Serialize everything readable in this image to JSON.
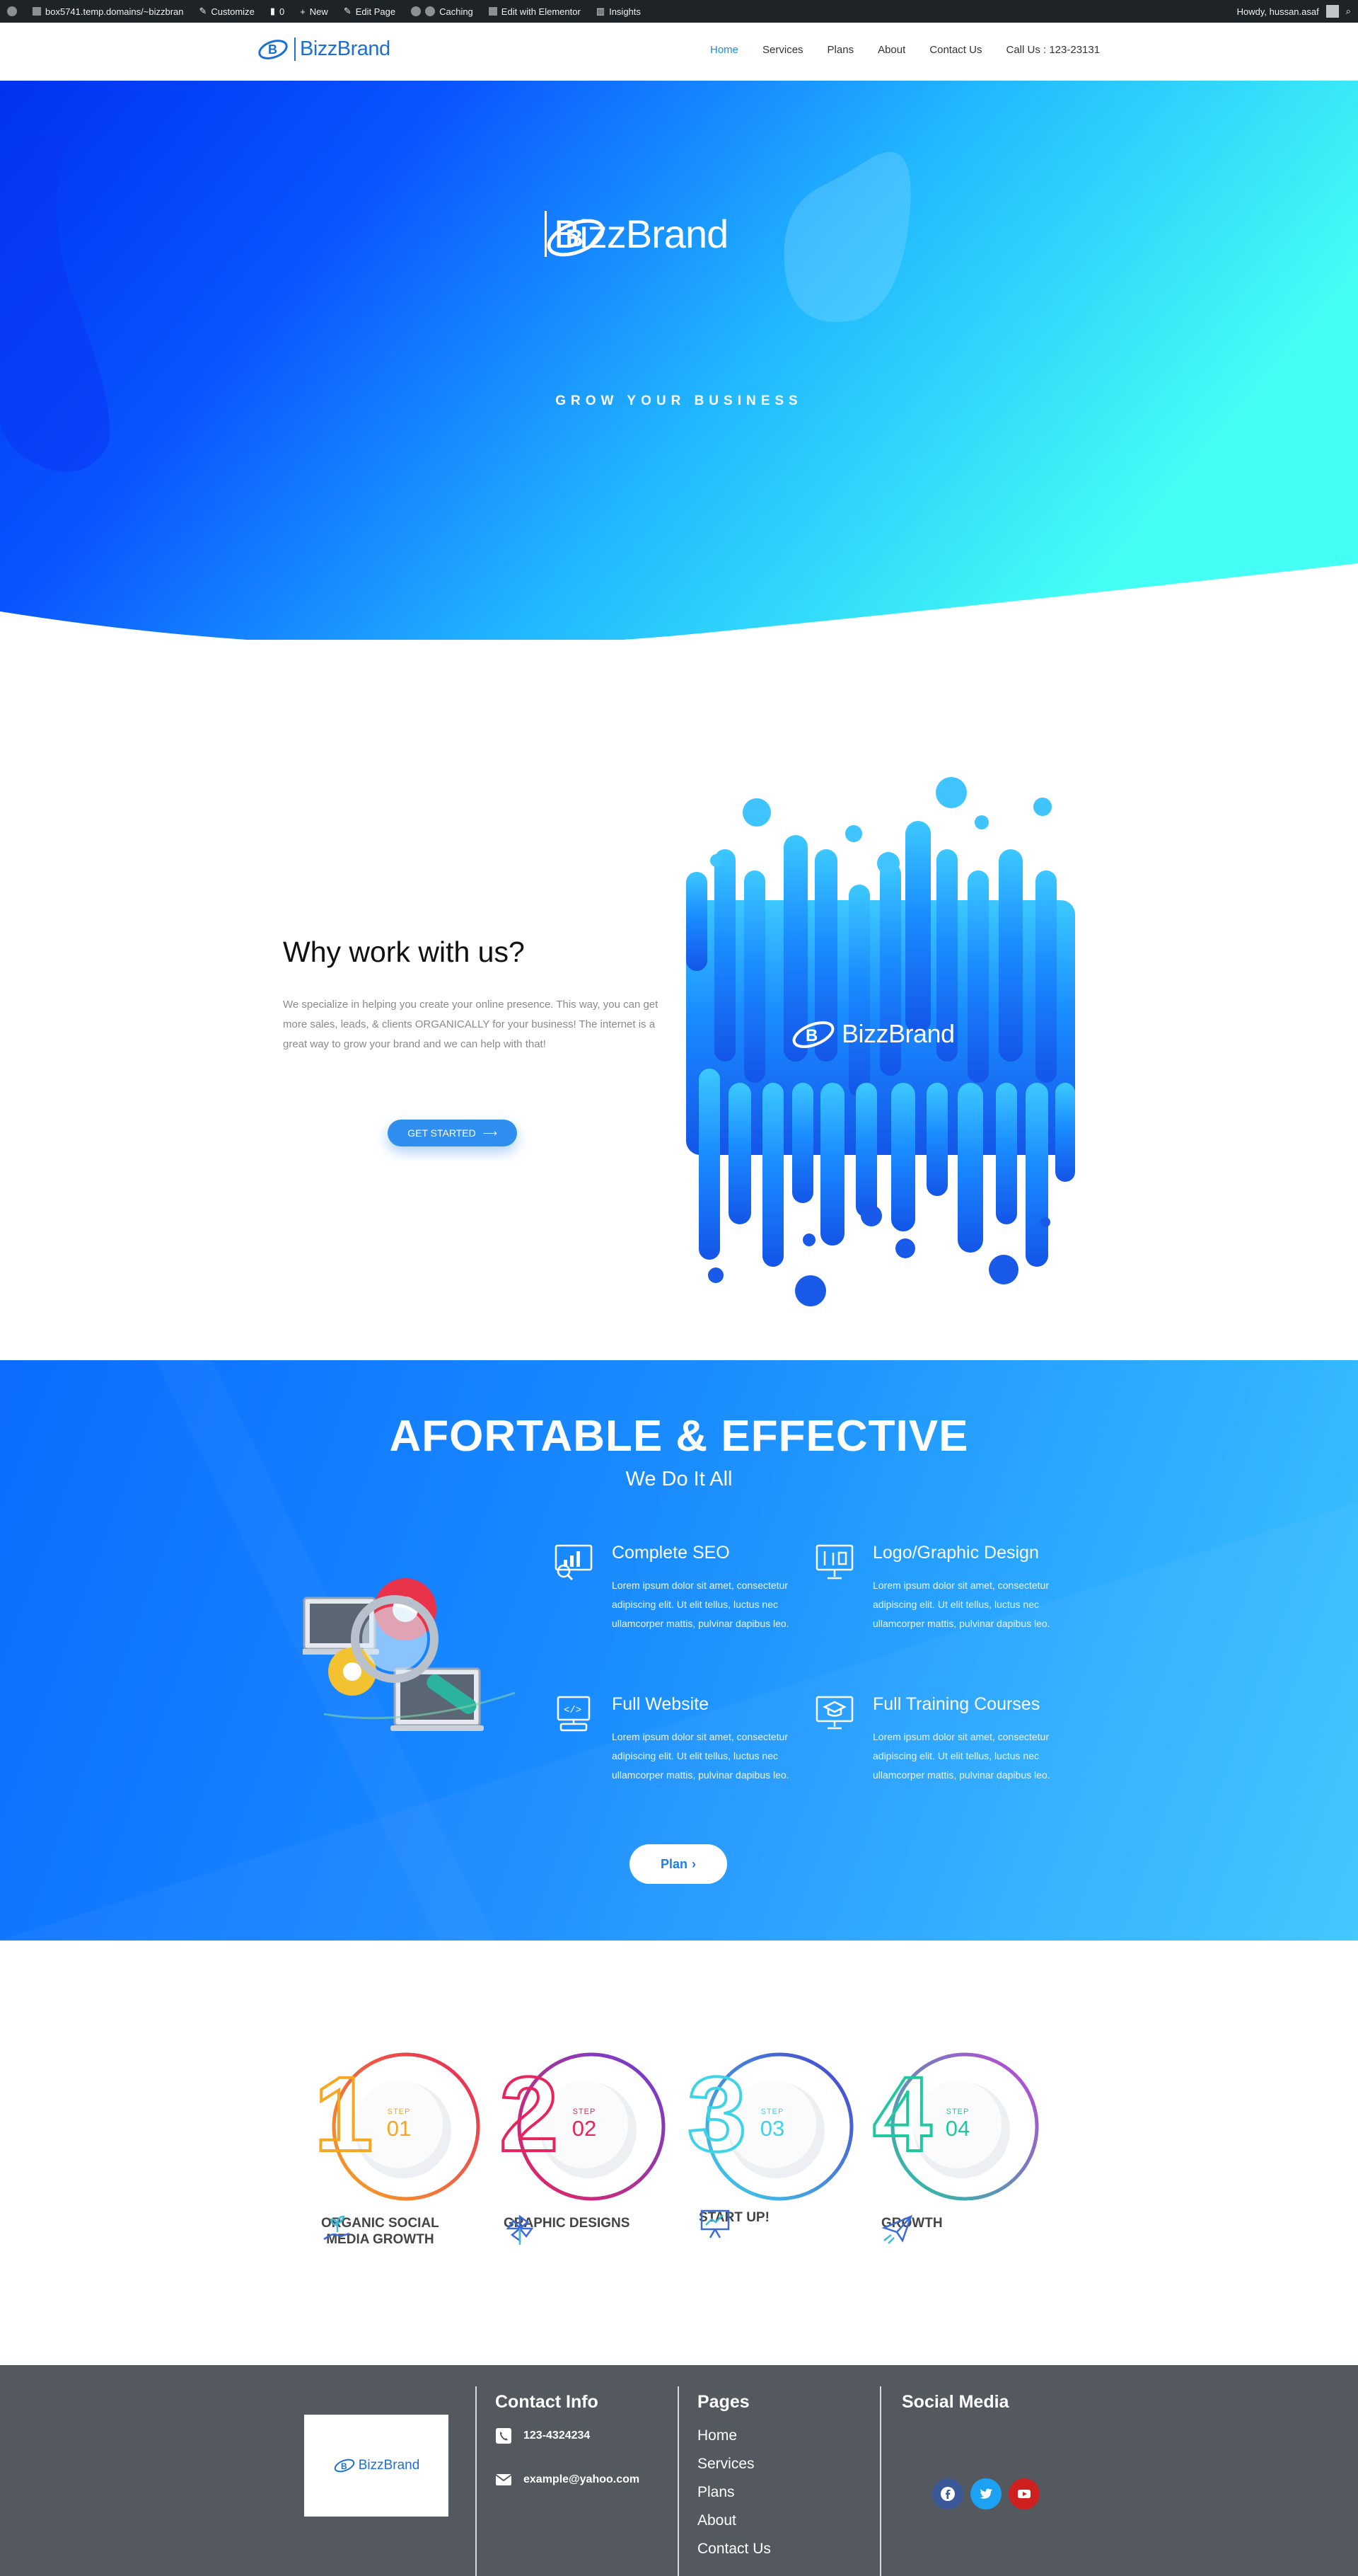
{
  "admin_bar": {
    "site": "box5741.temp.domains/~bizzbran",
    "customize": "Customize",
    "comments": "0",
    "new": "New",
    "edit_page": "Edit Page",
    "caching": "Caching",
    "edit_elementor": "Edit with Elementor",
    "insights": "Insights",
    "howdy": "Howdy, hussan.asaf"
  },
  "header": {
    "logo_text": "BizzBrand",
    "nav": [
      "Home",
      "Services",
      "Plans",
      "About",
      "Contact Us",
      "Call Us : 123-23131"
    ],
    "active": "Home"
  },
  "hero": {
    "logo_text": "BizzBrand",
    "tagline": "GROW YOUR BUSINESS"
  },
  "why": {
    "title": "Why work with us?",
    "text": "We specialize in helping you create your online presence. This way, you can get more sales, leads, & clients ORGANICALLY for your business! The internet is a great way to grow your brand  and we can help with that!",
    "button": "GET STARTED",
    "image_logo_text": "BizzBrand"
  },
  "services": {
    "title": "AFORTABLE & EFFECTIVE",
    "subtitle": "We Do It All",
    "items": [
      {
        "title": "Complete SEO",
        "text": "Lorem ipsum dolor sit amet, consectetur adipiscing elit. Ut elit tellus, luctus nec ullamcorper mattis, pulvinar dapibus leo.",
        "icon": "seo-chart-icon"
      },
      {
        "title": "Logo/Graphic Design",
        "text": "Lorem ipsum dolor sit amet, consectetur adipiscing elit. Ut elit tellus, luctus nec ullamcorper mattis, pulvinar dapibus leo.",
        "icon": "design-board-icon"
      },
      {
        "title": "Full Website",
        "text": "Lorem ipsum dolor sit amet, consectetur adipiscing elit. Ut elit tellus, luctus nec ullamcorper mattis, pulvinar dapibus leo.",
        "icon": "code-monitor-icon"
      },
      {
        "title": "Full Training Courses",
        "text": "Lorem ipsum dolor sit amet, consectetur adipiscing elit. Ut elit tellus, luctus nec ullamcorper mattis, pulvinar dapibus leo.",
        "icon": "graduation-monitor-icon"
      }
    ],
    "plan_button": "Plan"
  },
  "steps": [
    {
      "big": "1",
      "step_word": "STEP",
      "num": "01",
      "caption_line1": "ORGANIC SOCIAL",
      "caption_line2": "MEDIA GROWTH",
      "color": "#f5a623",
      "icon": "hand-plant-icon"
    },
    {
      "big": "2",
      "step_word": "STEP",
      "num": "02",
      "caption_line1": "GRAPHIC DESIGNS",
      "caption_line2": "",
      "color": "#e8245c",
      "icon": "pinwheel-icon"
    },
    {
      "big": "3",
      "step_word": "STEP",
      "num": "03",
      "caption_line1": "START UP!",
      "caption_line2": "",
      "color": "#3fd3e8",
      "icon": "presentation-icon"
    },
    {
      "big": "4",
      "step_word": "STEP",
      "num": "04",
      "caption_line1": "GROWTH",
      "caption_line2": "",
      "color": "#20c8a0",
      "icon": "paper-plane-icon"
    }
  ],
  "footer": {
    "logo_text": "BizzBrand",
    "contact_heading": "Contact Info",
    "phone": "123-4324234",
    "email": "example@yahoo.com",
    "pages_heading": "Pages",
    "pages": [
      "Home",
      "Services",
      "Plans",
      "About",
      "Contact Us"
    ],
    "social_heading": "Social Media",
    "social": [
      {
        "name": "facebook-icon",
        "color": "#3b5998"
      },
      {
        "name": "twitter-icon",
        "color": "#1da1f2"
      },
      {
        "name": "youtube-icon",
        "color": "#cd201f"
      }
    ]
  }
}
